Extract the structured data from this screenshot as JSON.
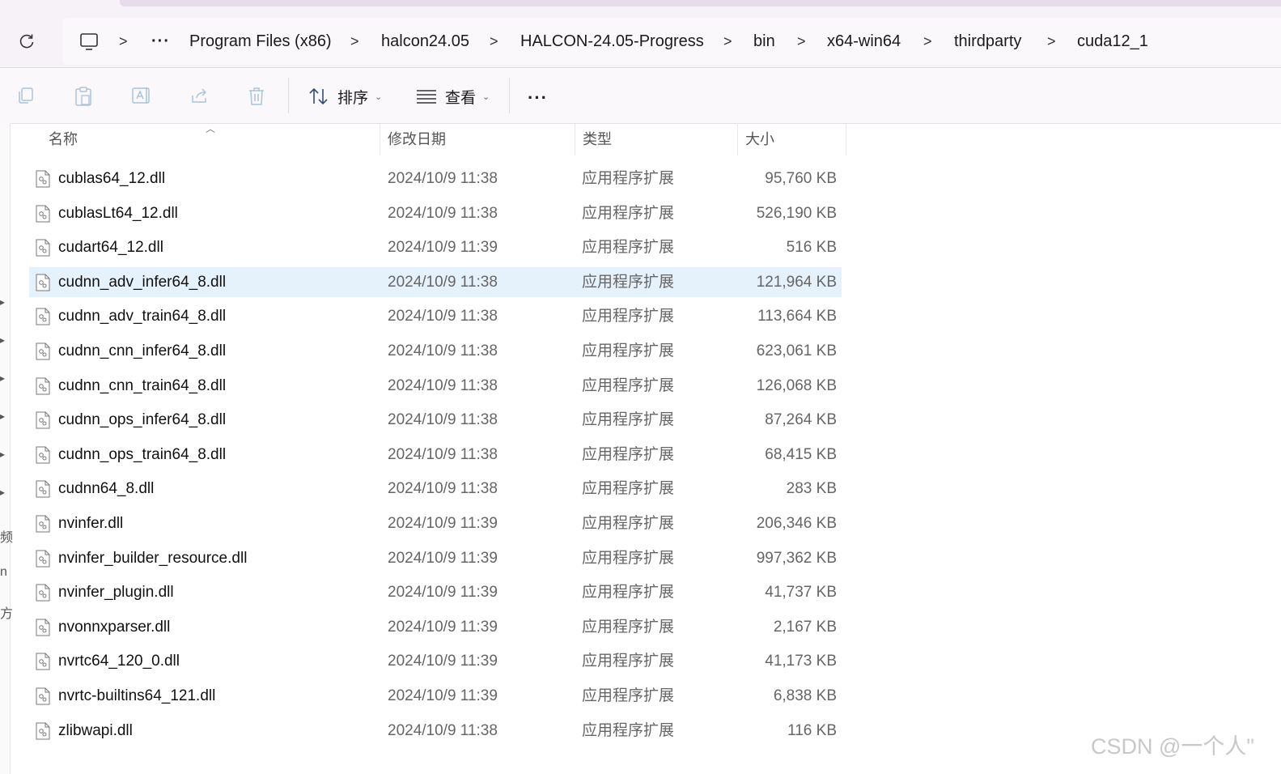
{
  "breadcrumb": {
    "more": "···",
    "items": [
      "Program Files (x86)",
      "halcon24.05",
      "HALCON-24.05-Progress",
      "bin",
      "x64-win64",
      "thirdparty",
      "cuda12_1"
    ],
    "separator": ">"
  },
  "toolbar": {
    "sort_label": "排序",
    "view_label": "查看",
    "more": "···"
  },
  "columns": {
    "name": "名称",
    "date": "修改日期",
    "type": "类型",
    "size": "大小"
  },
  "files": [
    {
      "name": "cublas64_12.dll",
      "date": "2024/10/9 11:38",
      "type": "应用程序扩展",
      "size": "95,760 KB"
    },
    {
      "name": "cublasLt64_12.dll",
      "date": "2024/10/9 11:38",
      "type": "应用程序扩展",
      "size": "526,190 KB"
    },
    {
      "name": "cudart64_12.dll",
      "date": "2024/10/9 11:39",
      "type": "应用程序扩展",
      "size": "516 KB"
    },
    {
      "name": "cudnn_adv_infer64_8.dll",
      "date": "2024/10/9 11:38",
      "type": "应用程序扩展",
      "size": "121,964 KB",
      "selected": true
    },
    {
      "name": "cudnn_adv_train64_8.dll",
      "date": "2024/10/9 11:38",
      "type": "应用程序扩展",
      "size": "113,664 KB"
    },
    {
      "name": "cudnn_cnn_infer64_8.dll",
      "date": "2024/10/9 11:38",
      "type": "应用程序扩展",
      "size": "623,061 KB"
    },
    {
      "name": "cudnn_cnn_train64_8.dll",
      "date": "2024/10/9 11:38",
      "type": "应用程序扩展",
      "size": "126,068 KB"
    },
    {
      "name": "cudnn_ops_infer64_8.dll",
      "date": "2024/10/9 11:38",
      "type": "应用程序扩展",
      "size": "87,264 KB"
    },
    {
      "name": "cudnn_ops_train64_8.dll",
      "date": "2024/10/9 11:38",
      "type": "应用程序扩展",
      "size": "68,415 KB"
    },
    {
      "name": "cudnn64_8.dll",
      "date": "2024/10/9 11:38",
      "type": "应用程序扩展",
      "size": "283 KB"
    },
    {
      "name": "nvinfer.dll",
      "date": "2024/10/9 11:39",
      "type": "应用程序扩展",
      "size": "206,346 KB"
    },
    {
      "name": "nvinfer_builder_resource.dll",
      "date": "2024/10/9 11:39",
      "type": "应用程序扩展",
      "size": "997,362 KB"
    },
    {
      "name": "nvinfer_plugin.dll",
      "date": "2024/10/9 11:39",
      "type": "应用程序扩展",
      "size": "41,737 KB"
    },
    {
      "name": "nvonnxparser.dll",
      "date": "2024/10/9 11:39",
      "type": "应用程序扩展",
      "size": "2,167 KB"
    },
    {
      "name": "nvrtc64_120_0.dll",
      "date": "2024/10/9 11:39",
      "type": "应用程序扩展",
      "size": "41,173 KB"
    },
    {
      "name": "nvrtc-builtins64_121.dll",
      "date": "2024/10/9 11:39",
      "type": "应用程序扩展",
      "size": "6,838 KB"
    },
    {
      "name": "zlibwapi.dll",
      "date": "2024/10/9 11:38",
      "type": "应用程序扩展",
      "size": "116 KB"
    }
  ],
  "left_edge_chars": [
    "频",
    "n",
    "方"
  ],
  "watermark": "CSDN @一个人\"",
  "colors": {
    "selection": "#e5f1fb",
    "chrome": "#f7f1f8"
  }
}
